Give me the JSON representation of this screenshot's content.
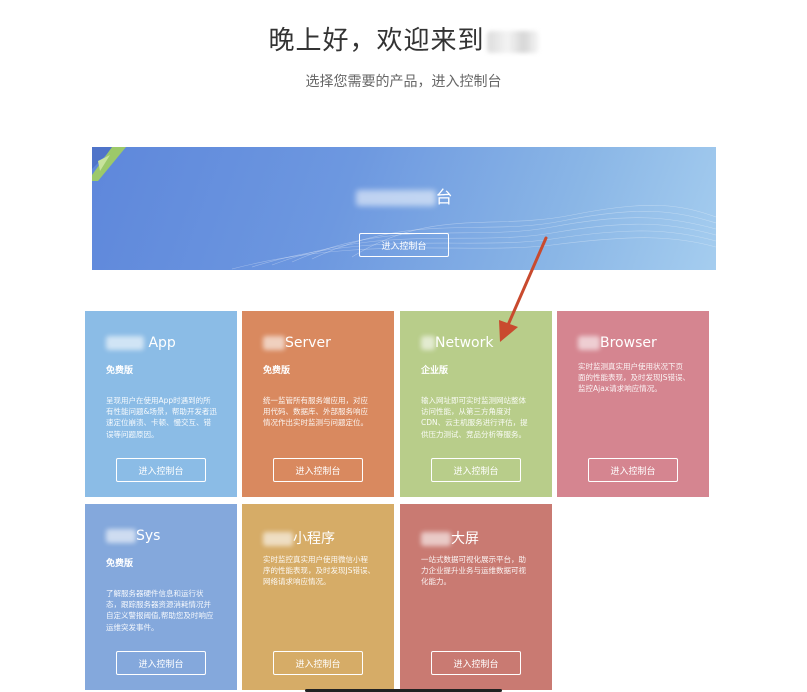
{
  "header": {
    "greeting": "晚上好，欢迎来到",
    "subtitle": "选择您需要的产品，进入控制台"
  },
  "banner": {
    "title": "台",
    "button_label": "进入控制台",
    "color_start": "#5e87db",
    "color_end": "#a5cdef"
  },
  "cards": [
    {
      "title_suffix": "App",
      "edition": "免费版",
      "description": "呈现用户在使用App时遇到的所有性能问题&场景，帮助开发者迅速定位崩溃、卡顿、慢交互、错误等问题原因。",
      "button_label": "进入控制台",
      "color": "#8bbce6"
    },
    {
      "title_suffix": "Server",
      "edition": "免费版",
      "description": "统一监管所有服务端应用，对应用代码、数据库、外部服务响应情况作出实时监测与问题定位。",
      "button_label": "进入控制台",
      "color": "#d9895f"
    },
    {
      "title_suffix": "Network",
      "edition": "企业版",
      "description": "输入网址即可实时监测网站整体访问性能，从第三方角度对CDN、云主机服务进行评估，提供压力测试、竞品分析等服务。",
      "button_label": "进入控制台",
      "color": "#b8cd8a"
    },
    {
      "title_suffix": "Browser",
      "edition": "",
      "description": "实时监测真实用户使用状况下页面的性能表现，及时发现JS错误、监控Ajax请求响应情况。",
      "button_label": "进入控制台",
      "color": "#d58590"
    },
    {
      "title_suffix": "Sys",
      "edition": "免费版",
      "description": "了解服务器硬件信息和运行状态，跟踪服务器资源消耗情况并自定义警报阈值,帮助您及时响应运维突发事件。",
      "button_label": "进入控制台",
      "color": "#84a8dc"
    },
    {
      "title_suffix": "小程序",
      "edition": "",
      "description": "实时监控真实用户使用微信小程序的性能表现，及时发现JS错误、网络请求响应情况。",
      "button_label": "进入控制台",
      "color": "#d6ac67"
    },
    {
      "title_suffix": "大屏",
      "edition": "",
      "description": "一站式数据可视化展示平台，助力企业提升业务与运维数据可视化能力。",
      "button_label": "进入控制台",
      "color": "#c97a72"
    }
  ],
  "annotation_color": "#c94a2e"
}
